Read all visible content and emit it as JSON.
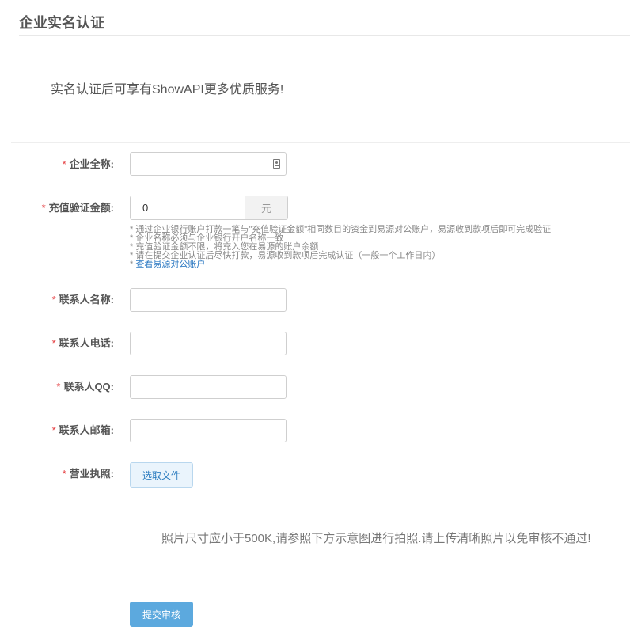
{
  "page_title": "企业实名认证",
  "intro": "实名认证后可享有ShowAPI更多优质服务!",
  "required_mark": "*",
  "form": {
    "company_name": {
      "label": "企业全称:",
      "value": ""
    },
    "amount": {
      "label": "充值验证金额:",
      "value": "0",
      "unit": "元"
    },
    "hints": [
      "* 通过企业银行账户打款一笔与\"充值验证金额\"相同数目的资金到易源对公账户，易源收到款项后即可完成验证",
      "* 企业名称必须与企业银行开户名称一致",
      "* 充值验证金额不限，将充入您在易源的账户余额",
      "* 请在提交企业认证后尽快打款，易源收到款项后完成认证（一般一个工作日内）"
    ],
    "hint_link_prefix": "* ",
    "hint_link": "查看易源对公账户",
    "contact_name": {
      "label": "联系人名称:",
      "value": ""
    },
    "contact_phone": {
      "label": "联系人电话:",
      "value": ""
    },
    "contact_qq": {
      "label": "联系人QQ:",
      "value": ""
    },
    "contact_email": {
      "label": "联系人邮箱:",
      "value": ""
    },
    "license": {
      "label": "营业执照:",
      "button": "选取文件"
    },
    "photo_note": "照片尺寸应小于500K,请参照下方示意图进行拍照.请上传清晰照片以免审核不通过!",
    "submit": "提交审核"
  }
}
